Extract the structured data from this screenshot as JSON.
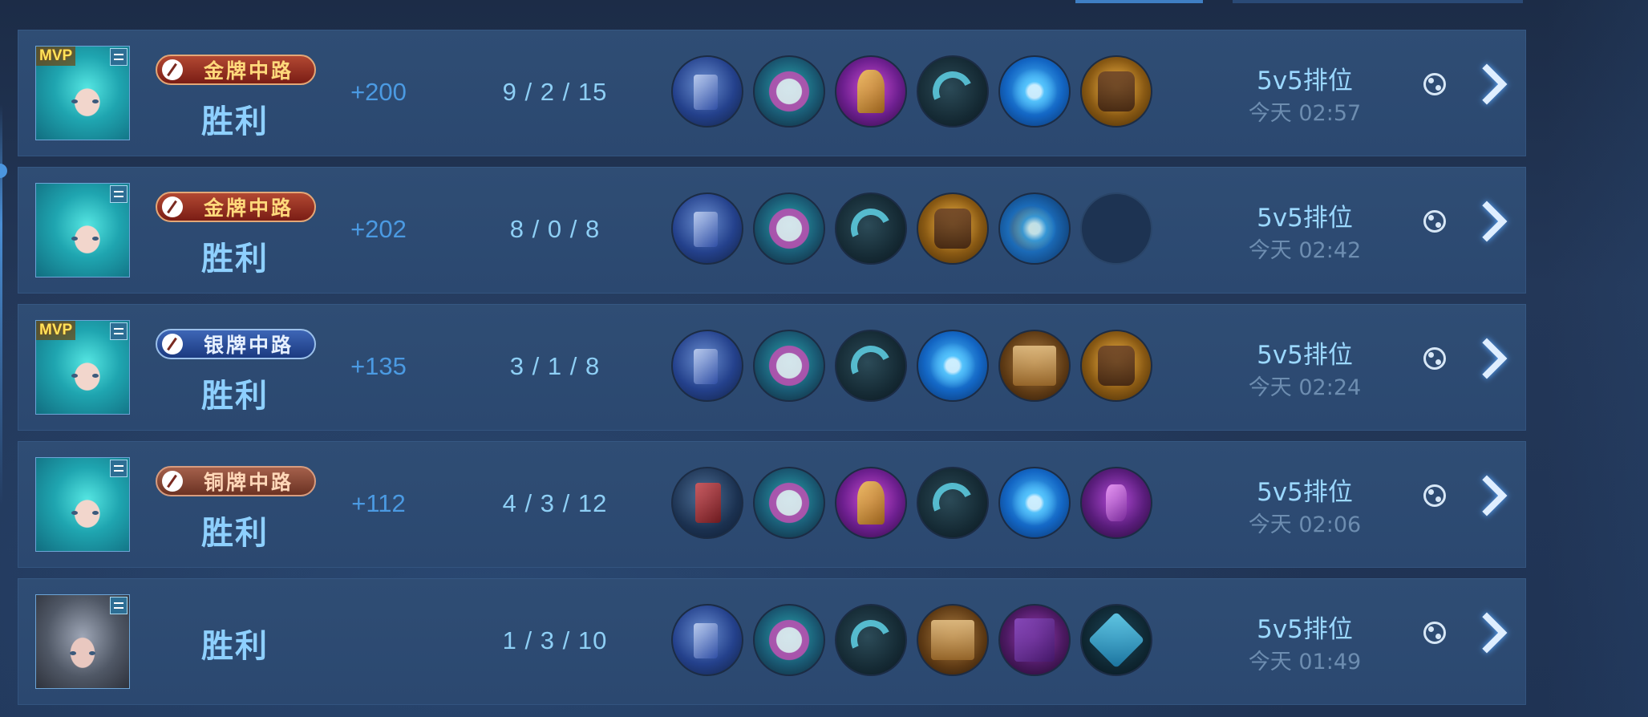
{
  "matches": [
    {
      "mvp": "MVP",
      "badge": "金牌中路",
      "badge_tier": "gold",
      "result": "胜利",
      "points": "+200",
      "kda": "9 / 2 / 15",
      "items": [
        "boots-item-icon",
        "mask-item-icon",
        "serpent-item-icon",
        "axe-item-icon",
        "orb-item-icon",
        "shield-item-icon"
      ],
      "mode": "5v5排位",
      "time": "今天 02:57"
    },
    {
      "mvp": "",
      "badge": "金牌中路",
      "badge_tier": "gold",
      "result": "胜利",
      "points": "+202",
      "kda": "8 / 0 / 8",
      "items": [
        "boots-item-icon",
        "mask-item-icon",
        "axe-item-icon",
        "shield-item-icon",
        "orb2-item-icon",
        "empty-slot"
      ],
      "mode": "5v5排位",
      "time": "今天 02:42"
    },
    {
      "mvp": "MVP",
      "badge": "银牌中路",
      "badge_tier": "silver",
      "result": "胜利",
      "points": "+135",
      "kda": "3 / 1 / 8",
      "items": [
        "boots-item-icon",
        "mask-item-icon",
        "axe-item-icon",
        "orb-item-icon",
        "tome-item-icon",
        "shield-item-icon"
      ],
      "mode": "5v5排位",
      "time": "今天 02:24"
    },
    {
      "mvp": "",
      "badge": "铜牌中路",
      "badge_tier": "bronze",
      "result": "胜利",
      "points": "+112",
      "kda": "4 / 3 / 12",
      "items": [
        "red-boots-item-icon",
        "mask-item-icon",
        "serpent-item-icon",
        "axe-item-icon",
        "orb-item-icon",
        "wand-item-icon"
      ],
      "mode": "5v5排位",
      "time": "今天 02:06"
    },
    {
      "mvp": "",
      "badge": "",
      "badge_tier": "",
      "result": "胜利",
      "points": "",
      "kda": "1 / 3 / 10",
      "items": [
        "boots-item-icon",
        "mask-item-icon",
        "axe-item-icon",
        "tome-item-icon",
        "spellbook-item-icon",
        "rune-item-icon"
      ],
      "mode": "5v5排位",
      "time": "今天 01:49"
    }
  ],
  "colors": {
    "background": "#233758",
    "row": "#2d4a71",
    "result_text": "#8ed0ff",
    "points_text": "#4b9ae2",
    "mode_text": "#9bd8ff",
    "time_text": "#6d8db0"
  }
}
